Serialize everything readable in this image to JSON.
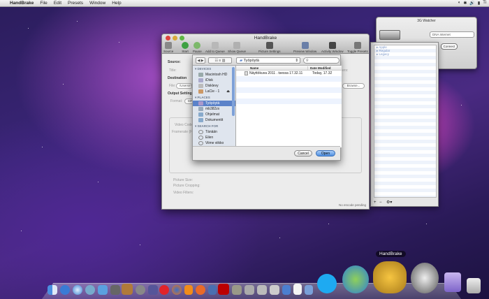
{
  "menubar": {
    "app": "HandBrake",
    "items": [
      "File",
      "Edit",
      "Presets",
      "Window",
      "Help"
    ],
    "status": [
      "◐",
      "✱",
      "🔊",
      "▮",
      "Ti"
    ]
  },
  "handbrake": {
    "title": "HandBrake",
    "toolbar": [
      "Source",
      "Start",
      "Pause",
      "Add to Queue",
      "Show Queue",
      "Picture Settings",
      "Preview Window",
      "Activity Window",
      "Toggle Presets"
    ],
    "source_label": "Source:",
    "title_label": "Title:",
    "destination_label": "Destination",
    "file_label": "File:",
    "file_value": "/Users/m",
    "browse": "Browse...",
    "output_label": "Output Settings",
    "format_label": "Format:",
    "format_value": "MP4",
    "video_codec": "Video Codec",
    "framerate": "Framerate (FPS)",
    "picture_size": "Picture Size:",
    "picture_cropping": "Picture Cropping:",
    "video_filters": "Video Filters:",
    "status": "No encode pending",
    "side_tab": "ers:"
  },
  "dialog": {
    "location": "Työpöytä",
    "search_placeholder": "",
    "devices_header": "DEVICES",
    "devices": [
      "Macintosh HD",
      "iDisk",
      "Disklevy",
      "LaCie - 1"
    ],
    "places_header": "PLACES",
    "places": [
      "Työpöytä",
      "mb382zx",
      "Ohjelmat",
      "Dokumentit"
    ],
    "search_header": "SEARCH FOR",
    "searches": [
      "Tänään",
      "Eilen",
      "Viime viikko"
    ],
    "col_name": "Name",
    "col_date": "Date Modified",
    "files": [
      {
        "name": "Näyttökuva 2011 . tsessa 17.32.11",
        "date": "Today, 17.32"
      }
    ],
    "cancel": "Cancel",
    "open": "Open"
  },
  "watcher": {
    "title": "3G Watcher",
    "network": "DNA Internet",
    "connect": "Connect"
  },
  "presets": {
    "items": [
      "Apple",
      "Regular",
      "Legacy"
    ]
  },
  "dock": {
    "tooltip": "HandBrake"
  },
  "colors": {
    "accent": "#5b82c9",
    "wallpaper": "#3a2577"
  }
}
